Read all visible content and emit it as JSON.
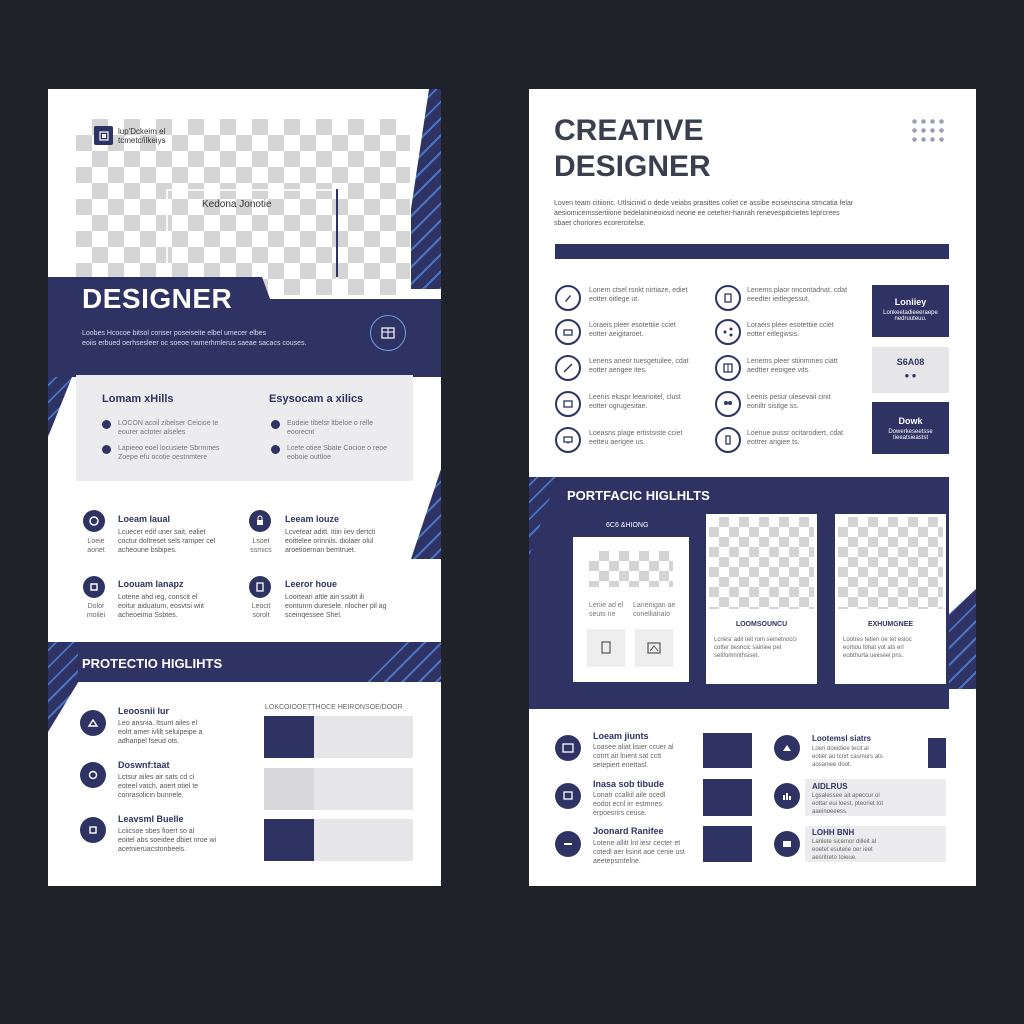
{
  "left": {
    "logo_text_1": "lup'Dckeim el",
    "logo_text_2": "tcmetc/ilkeiys",
    "photo_caption": "Kedona Jonotie",
    "title": "DESIGNER",
    "intro_1": "Loobes Hcocoe bitsol conser poseiseite elbel umecer elbes",
    "intro_2": "eoiis erbued oerhsesleer oc soeoe namerhmlerus saeae sacacs couses.",
    "skills": {
      "col1_title": "Lomam xHills",
      "col1_items": [
        [
          "LOCON acoil zibelser Ceicioe te",
          "eourer actoter alseles"
        ],
        [
          "Lapieeo eoel locusiete Sbrmmes",
          "Zoepe efu ocotie oestnmtere"
        ]
      ],
      "col2_title": "Esysocam a xilics",
      "col2_items": [
        [
          "Eudeie tibelsr ltbeloe o relle",
          "eoorecnt"
        ],
        [
          "Lcete otiee Sbate Cocioe o reoe",
          "eoboie outtloe"
        ]
      ]
    },
    "features": [
      {
        "title": "Loeam laual",
        "side": "Loeie aonet",
        "l1": "Lcuecer edif uner sait, ealiet",
        "l2": "coctur doltreset sels ramper cel",
        "l3": "acheoune bsbipes."
      },
      {
        "title": "Leeam louze",
        "side": "Lsoet ssmics",
        "l1": "Lcvetear aditt. Itiin iiev dertcti",
        "l2": "eoittelee orinniis. diolaer olul",
        "l3": "aroetioernan bemtruet."
      },
      {
        "title": "Loouam lanapz",
        "side": "Dolor moilei",
        "l1": "Lotene ahd ieg, conscit el",
        "l2": "eoitur aiduatum, eosvtsi wiit",
        "l3": "acheoeima Ssbtes."
      },
      {
        "title": "Leeror houe",
        "side": "Leocit sorolt",
        "l1": "Loortean attle ain ssutit ili",
        "l2": "eontunm duresele. nlocher pil ag",
        "l3": "sceinqessee Shel."
      }
    ],
    "section_title": "PROTECTIO HIGLIHTS",
    "projects": [
      {
        "title": "Leoosnii lur",
        "l1": "Leo ansnia. Itsunt ailes el",
        "l2": "eolrt amer ivlilt seluipeipe a",
        "l3": "adhanpel fseud ots."
      },
      {
        "title": "Doswnf:taat",
        "l1": "Lctsur ailes air sats cd ci",
        "l2": "eoteel vatch, aoert otiel te",
        "l3": "conrasolicin bunnele."
      },
      {
        "title": "Leavsml Buelle",
        "l1": "Lciicsoe sbes fioert so al",
        "l2": "eoitel abs soeidee dbiet nroe wi",
        "l3": "acetnieruacstonbeels."
      }
    ],
    "table_caption": "LOKCOIOOETTHOCE HEIRONSOE/DOOR"
  },
  "right": {
    "title_1": "CREATIVE",
    "title_2": "DESIGNER",
    "intro_1": "Loven team citiioric. Utlsicinid o dede veiabs prasittes coliet ce assibe eciseinscina stmcatia felar",
    "intro_2": "aesiomicemssertiione bedelanineoiosd neone ee ceteher-hanrah renevespiticietes leprcrees",
    "intro_3": "sbaet choriores ecorercitelse.",
    "services": [
      {
        "l1": "Lonem ctsel rsnkt nirtiaze, ediet",
        "l2": "eotter oitlege ut."
      },
      {
        "l1": "Loraeis pleer esotettiie cciet",
        "l2": "eotter aeigitaroet."
      },
      {
        "l1": "Lenens aneor tuesgetuilee, cdat",
        "l2": "eotter aerigee ites."
      },
      {
        "l1": "Leenis eluspr leeanoitel, clust",
        "l2": "eotter ogrugesitae."
      },
      {
        "l1": "Loeasns plage ertistsiste cciet",
        "l2": "eetteu aerigee us."
      }
    ],
    "services2": [
      {
        "l1": "Lenems plaor nncontadnat, cdat",
        "l2": "eeedter ieitlegessut."
      },
      {
        "l1": "Loraeis pleer esotettiie cciet",
        "l2": "eotter eitlegwsis."
      },
      {
        "l1": "Lenems pleer stiinmmes ciatt",
        "l2": "aedtter eeoigee vits."
      },
      {
        "l1": "Leenis pesur ulesevaii cinit",
        "l2": "eoniltr sisitge ss."
      },
      {
        "l1": "Loenue pussr ocitarodiert, cdat",
        "l2": "eottrer arigiee ts."
      }
    ],
    "badges": [
      {
        "title": "Loniiey",
        "sub1": "Lonkeetadieeeraepe",
        "sub2": "nedruuteuu."
      },
      {
        "title": "S6A08",
        "sub1": "",
        "sub2": ""
      },
      {
        "title": "Dowk",
        "sub1": "Dowerkeseetsse",
        "sub2": "tieeatsieastst"
      }
    ],
    "portfolio_title": "PORTFACIC HIGLHLTS",
    "portfolio_card_header": "6C6 &HIONG",
    "portfolio_card_text": [
      [
        "Lenie ad el",
        "seuts ne"
      ],
      [
        "Lanenigan ae",
        "conellianaio"
      ]
    ],
    "portfolio_captions": [
      {
        "title": "LOOMSOUNCU",
        "l1": "Lcriesr adit teit rom seinetnocci",
        "l2": "cotter tiesncic sairiiee pet",
        "l3": "setifomnnthsiset."
      },
      {
        "title": "EXHUMGNEE",
        "l1": "Lootres tetien oe tet esioc",
        "l2": "eortiou lbhat vot ats erl",
        "l3": "eobthurta ueiiseei pns."
      }
    ],
    "bottom": [
      {
        "title": "Loeam jiunts",
        "l1": "Loasee aliat lisier ccuer al",
        "l2": "cotrrt ait lnient sat cctt",
        "l3": "setepiert enettasl."
      },
      {
        "title": "Inasa sob tibude",
        "l1": "Lonatr ccalkil aile ocedl",
        "l2": "eodot ecnl irr estmnes",
        "l3": "erpoesrirs ceuse."
      },
      {
        "title": "Joonard Ranifee",
        "l1": "Lotene allitt lnt iesr cecter et",
        "l2": "cotedl aer lisinit aoe cenie ust",
        "l3": "aeetepsmtelne."
      }
    ],
    "bottom2": [
      {
        "title": "Lootemsl siatrs",
        "l1": "Loeri doeidiee tecit al",
        "l2": "eotier ao tcnrt casmurs ats",
        "l3": "aosaniee doot."
      },
      {
        "title": "AIDLRUS",
        "l1": "Lgsalessee ait apeccur ol",
        "l2": "eottar eui loest, pteoriet tot",
        "l3": "aaeinoeeess."
      },
      {
        "title": "LOHH BNH",
        "l1": "Lanlete sicemor dilleit al",
        "l2": "eoetet esuteiie oer ieet",
        "l3": "aesritreto toieue."
      }
    ]
  }
}
